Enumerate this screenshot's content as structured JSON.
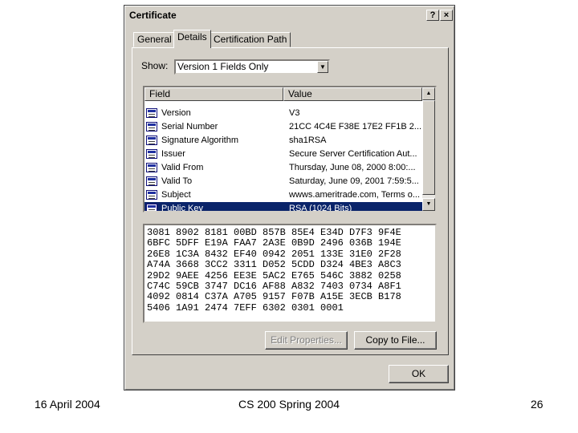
{
  "dialog": {
    "title": "Certificate",
    "help_button": "?",
    "close_button": "×",
    "tabs": [
      {
        "label": "General"
      },
      {
        "label": "Details"
      },
      {
        "label": "Certification Path"
      }
    ],
    "show_label": "Show:",
    "show_value": "Version 1 Fields Only",
    "columns": [
      "Field",
      "Value"
    ],
    "fields": [
      {
        "field": "Version",
        "value": "V3"
      },
      {
        "field": "Serial Number",
        "value": "21CC 4C4E F38E 17E2 FF1B 2..."
      },
      {
        "field": "Signature Algorithm",
        "value": "sha1RSA"
      },
      {
        "field": "Issuer",
        "value": "Secure Server Certification Aut..."
      },
      {
        "field": "Valid From",
        "value": "Thursday, June 08, 2000 8:00:..."
      },
      {
        "field": "Valid To",
        "value": "Saturday, June 09, 2001 7:59:5..."
      },
      {
        "field": "Subject",
        "value": "wwws.ameritrade.com, Terms o..."
      },
      {
        "field": "Public Key",
        "value": "RSA (1024 Bits)"
      }
    ],
    "selected_field": "Public Key",
    "hex_lines": [
      "3081 8902 8181 00BD 857B 85E4 E34D D7F3 9F4E",
      "6BFC 5DFF E19A FAA7 2A3E 0B9D 2496 036B 194E",
      "26E8 1C3A 8432 EF40 0942 2051 133E 31E0 2F28",
      "A74A 3668 3CC2 3311 D052 5CDD D324 4BE3 A8C3",
      "29D2 9AEE 4256 EE3E 5AC2 E765 546C 3882 0258",
      "C74C 59CB 3747 DC16 AF88 A832 7403 0734 A8F1",
      "4092 0814 C37A A705 9157 F07B A15E 3ECB B178",
      "5406 1A91 2474 7EFF 6302 0301 0001"
    ],
    "edit_properties_label": "Edit Properties...",
    "copy_to_file_label": "Copy to File...",
    "ok_label": "OK"
  },
  "footer": {
    "date": "16 April 2004",
    "course": "CS 200 Spring 2004",
    "page": "26"
  },
  "colors": {
    "face": "#d4d0c8",
    "selection": "#0a246a"
  }
}
